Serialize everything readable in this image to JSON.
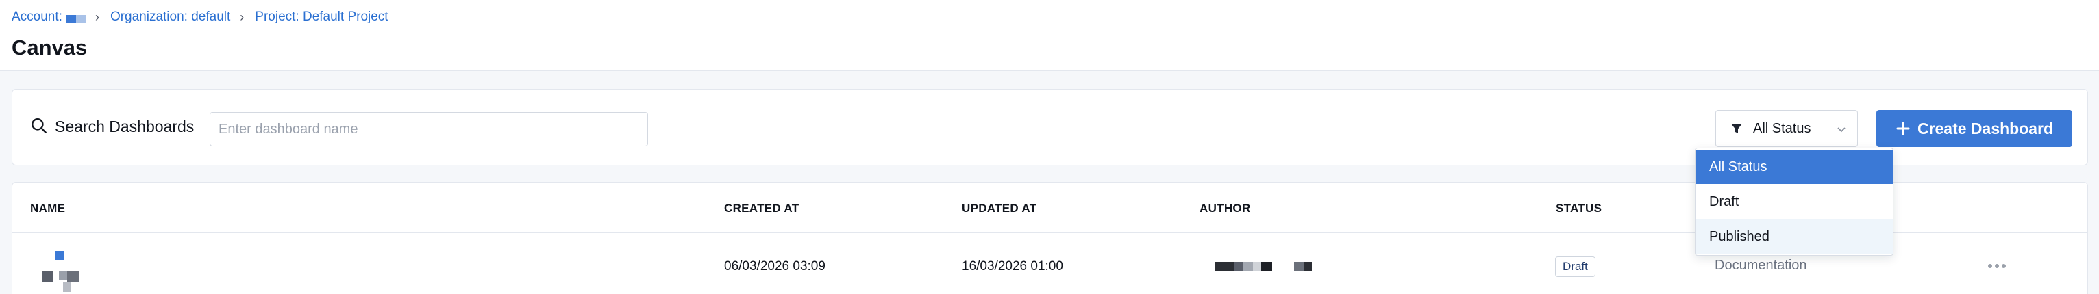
{
  "breadcrumb": {
    "account_label": "Account:",
    "organization": "Organization: default",
    "project": "Project: Default Project"
  },
  "page": {
    "title": "Canvas"
  },
  "toolbar": {
    "search_label": "Search Dashboards",
    "search_placeholder": "Enter dashboard name",
    "status_filter_value": "All Status",
    "create_label": "Create Dashboard"
  },
  "table": {
    "columns": [
      "NAME",
      "CREATED AT",
      "UPDATED AT",
      "AUTHOR",
      "STATUS"
    ],
    "rows": [
      {
        "created_at": "06/03/2026 03:09",
        "updated_at": "16/03/2026 01:00",
        "status": "Draft",
        "tag": "Documentation"
      }
    ]
  },
  "status_dropdown": {
    "options": [
      "All Status",
      "Draft",
      "Published"
    ],
    "selected": "All Status",
    "hovered": "Published"
  },
  "colors": {
    "accent": "#3b79d6",
    "link": "#2a6fd1"
  },
  "icons": {
    "search": "search-icon",
    "filter": "filter-icon",
    "chevron": "chevron-down-icon",
    "plus": "plus-icon",
    "more": "more-horizontal-icon"
  }
}
